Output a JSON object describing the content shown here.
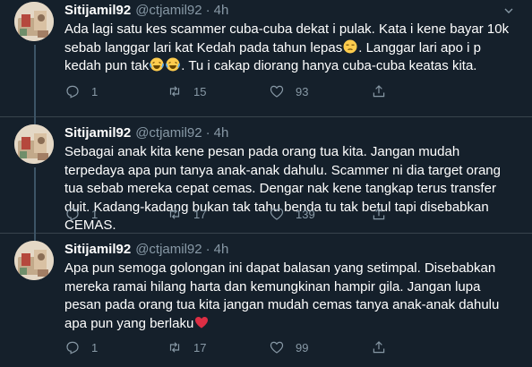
{
  "tweets": [
    {
      "display_name": "Sitijamil92",
      "handle": "@ctjamil92",
      "dot": "·",
      "time": "4h",
      "text_a": "Ada lagi satu kes scammer cuba-cuba dekat i pulak. Kata i kene bayar 10k sebab langgar lari kat Kedah pada tahun lepas",
      "text_b": ". Langgar lari apo i p kedah pun tak",
      "text_c": ". Tu i cakap diorang hanya cuba-cuba keatas kita.",
      "replies": "1",
      "retweets": "15",
      "likes": "93"
    },
    {
      "display_name": "Sitijamil92",
      "handle": "@ctjamil92",
      "dot": "·",
      "time": "4h",
      "text_a": "Sebagai anak kita kene pesan pada orang tua kita. Jangan mudah terpedaya apa pun tanya anak-anak dahulu. Scammer ni dia target orang tua sebab mereka cepat cemas. Dengar nak kene tangkap terus transfer duit. Kadang-kadang bukan tak tahu benda tu tak betul tapi disebabkan CEMAS.",
      "replies": "1",
      "retweets": "17",
      "likes": "139"
    },
    {
      "display_name": "Sitijamil92",
      "handle": "@ctjamil92",
      "dot": "·",
      "time": "4h",
      "text_a": "Apa pun semoga golongan ini dapat balasan yang setimpal. Disebabkan mereka ramai hilang harta dan kemungkinan hampir gila. Jangan lupa pesan pada orang tua kita jangan mudah cemas tanya anak-anak dahulu apa pun yang berlaku",
      "replies": "1",
      "retweets": "17",
      "likes": "99"
    }
  ],
  "icons": {
    "reply": "reply-icon",
    "retweet": "retweet-icon",
    "like": "heart-icon",
    "share": "share-icon",
    "more": "chevron-down-icon"
  },
  "colors": {
    "background": "#15202b",
    "secondary_text": "#8899a6",
    "divider": "#38444d"
  }
}
